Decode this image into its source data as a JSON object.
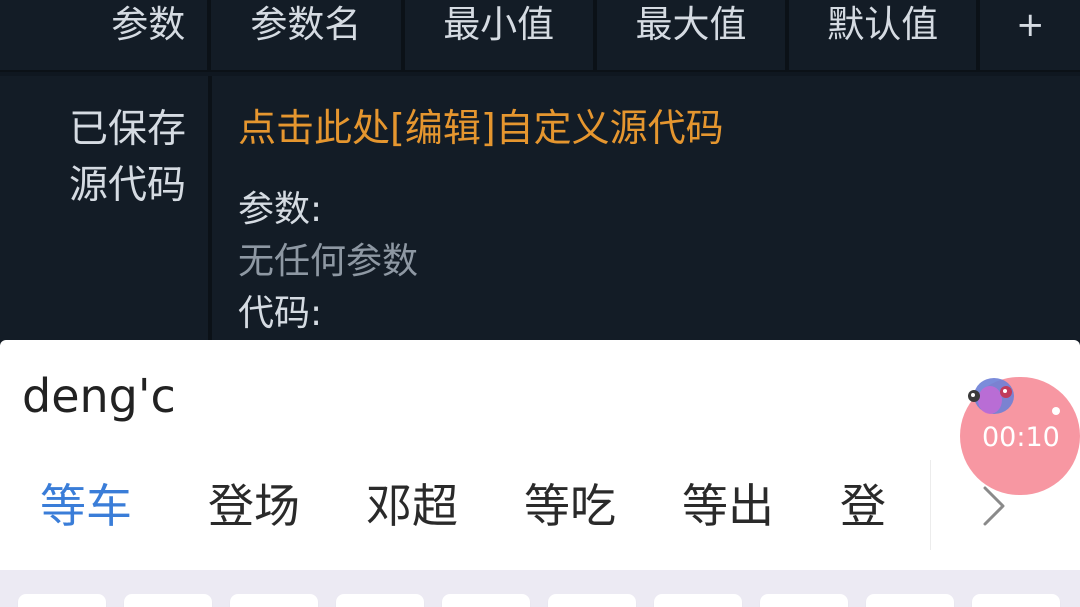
{
  "table": {
    "headers": [
      "参数",
      "参数名",
      "最小值",
      "最大值",
      "默认值",
      "+"
    ],
    "saved_label_line1": "已保存",
    "saved_label_line2": "源代码",
    "edit_link": "点击此处[编辑]自定义源代码",
    "params_heading": "参数:",
    "params_value": "无任何参数",
    "code_heading": "代码:"
  },
  "ime": {
    "composing_text": "deng'c",
    "candidates": [
      "等车",
      "登场",
      "邓超",
      "等吃",
      "等出",
      "登"
    ],
    "more_icon": "chevron-right-icon"
  },
  "recorder": {
    "timer": "00:10",
    "color": "#f5808e"
  },
  "colors": {
    "background": "#0f1720",
    "link_orange": "#e5962f",
    "selected_candidate_blue": "#3a7dd8"
  }
}
